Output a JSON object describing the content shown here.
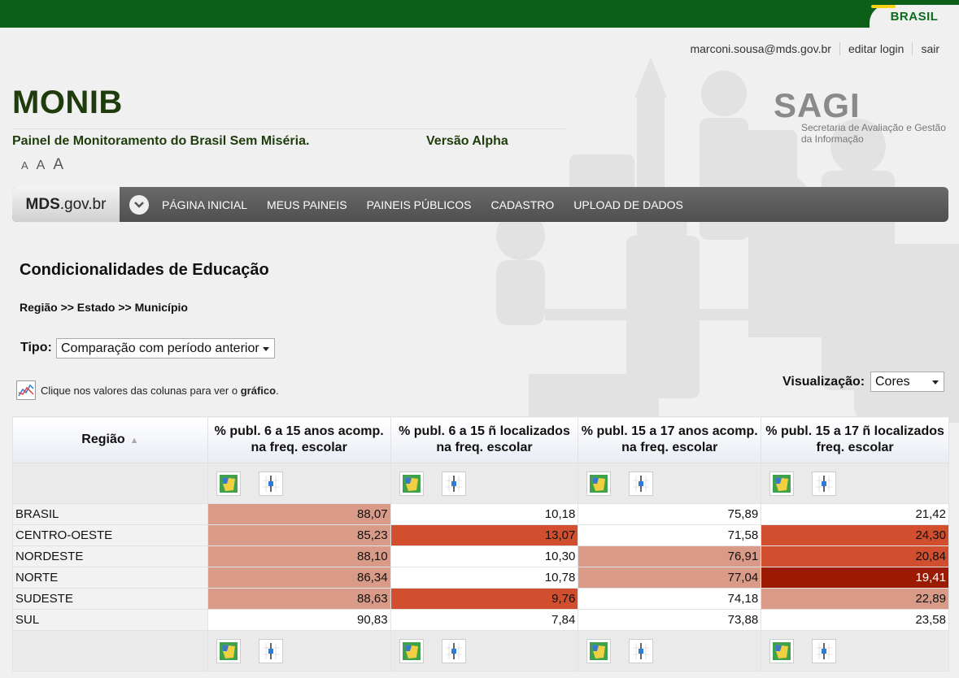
{
  "gov_bar": {
    "brand": "BRASIL"
  },
  "user": {
    "email": "marconi.sousa@mds.gov.br",
    "edit_login": "editar login",
    "logout": "sair"
  },
  "header": {
    "title": "MONIB",
    "subtitle": "Painel de Monitoramento do Brasil Sem Miséria.",
    "version": "Versão Alpha",
    "font_sizes": [
      "A",
      "A",
      "A"
    ],
    "sagi_title": "SAGI",
    "sagi_subtitle": "Secretaria de Avaliação e Gestão da Informação"
  },
  "nav": {
    "logo_bold": "MDS",
    "logo_rest": ".gov.br",
    "items": [
      "PÁGINA INICIAL",
      "MEUS PAINEIS",
      "PAINEIS PÚBLICOS",
      "CADASTRO",
      "UPLOAD DE DADOS"
    ]
  },
  "main": {
    "page_title": "Condicionalidades de Educação",
    "breadcrumb": "Região >> Estado >> Município",
    "tipo_label": "Tipo:",
    "tipo_value": "Comparação com período anterior",
    "hint_text": "Clique nos valores das colunas para ver o",
    "hint_bold": "gráfico",
    "hint_end": ".",
    "viz_label": "Visualização:",
    "viz_value": "Cores"
  },
  "table": {
    "headers": [
      "Região",
      "% publ. 6 a 15 anos acomp. na freq. escolar",
      "% publ. 6 a 15 ñ localizados na freq. escolar",
      "% publ. 15 a 17 anos acomp. na freq. escolar",
      "% publ. 15 a 17 ñ localizados freq. escolar"
    ],
    "rows": [
      {
        "name": "BRASIL",
        "values": [
          "88,07",
          "10,18",
          "75,89",
          "21,42"
        ]
      },
      {
        "name": "CENTRO-OESTE",
        "values": [
          "85,23",
          "13,07",
          "71,58",
          "24,30"
        ]
      },
      {
        "name": "NORDESTE",
        "values": [
          "88,10",
          "10,30",
          "76,91",
          "20,84"
        ]
      },
      {
        "name": "NORTE",
        "values": [
          "86,34",
          "10,78",
          "77,04",
          "19,41"
        ]
      },
      {
        "name": "SUDESTE",
        "values": [
          "88,63",
          "9,76",
          "74,18",
          "22,89"
        ]
      },
      {
        "name": "SUL",
        "values": [
          "90,83",
          "7,84",
          "73,88",
          "23,58"
        ]
      }
    ],
    "cell_colors": [
      [
        "#d99a88",
        "#ffffff",
        "#ffffff",
        "#ffffff"
      ],
      [
        "#d99a88",
        "#d14f2f",
        "#ffffff",
        "#d14f2f"
      ],
      [
        "#d99a88",
        "#ffffff",
        "#d99a88",
        "#d14f2f"
      ],
      [
        "#d99a88",
        "#ffffff",
        "#d99a88",
        "#9c1a02"
      ],
      [
        "#d99a88",
        "#d14f2f",
        "#ffffff",
        "#d99a88"
      ],
      [
        "#ffffff",
        "#ffffff",
        "#ffffff",
        "#ffffff"
      ]
    ],
    "cell_text_colors": [
      [
        "#111111",
        "#111111",
        "#111111",
        "#111111"
      ],
      [
        "#111111",
        "#111111",
        "#111111",
        "#111111"
      ],
      [
        "#111111",
        "#111111",
        "#111111",
        "#111111"
      ],
      [
        "#111111",
        "#111111",
        "#111111",
        "#ffffff"
      ],
      [
        "#111111",
        "#111111",
        "#111111",
        "#111111"
      ],
      [
        "#111111",
        "#111111",
        "#111111",
        "#111111"
      ]
    ]
  },
  "colors": {
    "gov_green": "#0c5e19",
    "title_green": "#1f3d0c",
    "heat_light": "#d99a88",
    "heat_mid": "#d14f2f",
    "heat_dark": "#9c1a02"
  }
}
